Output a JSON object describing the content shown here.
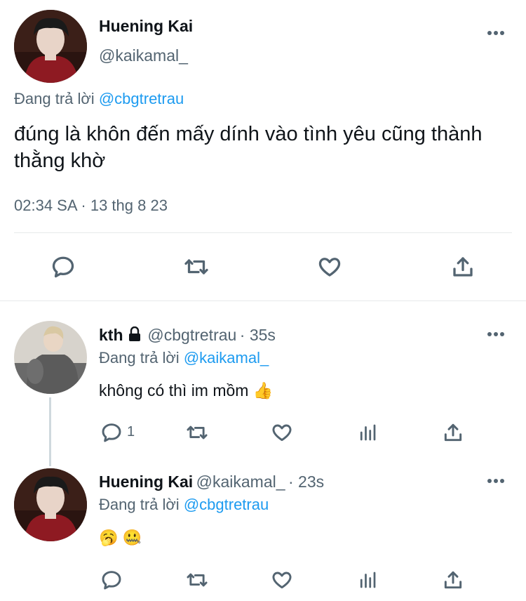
{
  "main_tweet": {
    "author_name": "Huening Kai",
    "handle": "@kaikamal_",
    "reply_prefix": "Đang trả lời",
    "reply_to": "@cbgtretrau",
    "text": "đúng là khôn đến mấy dính vào tình yêu cũng thành thằng khờ",
    "timestamp": "02:34 SA · 13 thg 8 23"
  },
  "replies": [
    {
      "author_name": "kth",
      "handle": "@cbgtretrau",
      "time": "· 35s",
      "reply_prefix": "Đang trả lời",
      "reply_to": "@kaikamal_",
      "text": "không có thì im mồm 👍",
      "reply_count": "1"
    },
    {
      "author_name": "Huening Kai",
      "handle": "@kaikamal_",
      "time": "· 23s",
      "reply_prefix": "Đang trả lời",
      "reply_to": "@cbgtretrau",
      "text": "🥱 🤐"
    }
  ],
  "colors": {
    "link": "#1d9bf0",
    "muted": "#536471",
    "text": "#0f1419",
    "divider": "#e7e9ea"
  }
}
